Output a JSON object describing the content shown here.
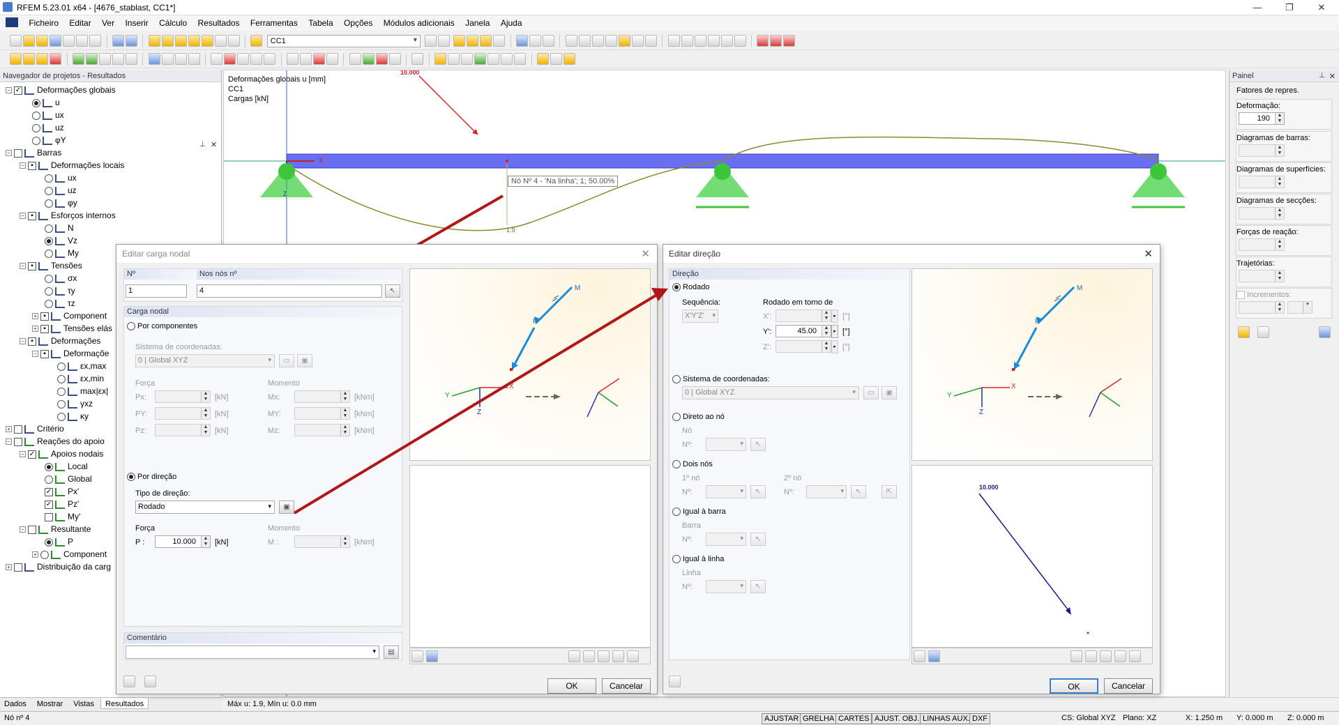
{
  "window": {
    "title": "RFEM 5.23.01 x64 - [4676_stablast, CC1*]",
    "min": "—",
    "max": "❐",
    "close": "✕"
  },
  "menu": [
    "Ficheiro",
    "Editar",
    "Ver",
    "Inserir",
    "Cálculo",
    "Resultados",
    "Ferramentas",
    "Tabela",
    "Opções",
    "Módulos adicionais",
    "Janela",
    "Ajuda"
  ],
  "toolbar": {
    "loadcase": "CC1"
  },
  "navigator": {
    "title": "Navegador de projetos - Resultados",
    "items": [
      "Deformações globais",
      "u",
      "ux",
      "uz",
      "φY",
      "Barras",
      "Deformações locais",
      "ux",
      "uz",
      "φy",
      "Esforços internos",
      "N",
      "Vz",
      "My",
      "Tensões",
      "σx",
      "τy",
      "τz",
      "Component",
      "Tensões elás",
      "Deformações",
      "Deformaçõe",
      "εx,max",
      "εx,min",
      "max|εx|",
      "γxz",
      "κy",
      "Critério",
      "Reações do apoio",
      "Apoios nodais",
      "Local",
      "Global",
      "Px'",
      "Pz'",
      "My'",
      "Resultante",
      "P",
      "Component",
      "Distribuição da carg"
    ],
    "tabs": [
      "Dados",
      "Mostrar",
      "Vistas",
      "Resultados"
    ]
  },
  "canvas": {
    "info_lines": [
      "Deformações globais u [mm]",
      "CC1",
      "Cargas [kN]"
    ],
    "load_value": "10.000",
    "node_tooltip": "Nó Nº 4 - 'Na linha'; 1; 50.00%",
    "defl_label": "1.9",
    "axis_x": "X",
    "axis_z": "Z"
  },
  "right_panel": {
    "title": "Painel",
    "heading": "Fatores de repres.",
    "deformacao_label": "Deformação:",
    "deformacao_value": "190",
    "labels": [
      "Diagramas de barras:",
      "Diagramas de superfícies:",
      "Diagramas de secções:",
      "Forças de reação:",
      "Trajetórias:",
      "Incrementos:"
    ]
  },
  "status": {
    "result_text": "Máx u: 1.9, Mín u: 0.0 mm",
    "node": "Nó nº 4",
    "buttons": [
      "AJUSTAR",
      "GRELHA",
      "CARTES",
      "AJUST. OBJ.",
      "LINHAS AUX.",
      "DXF"
    ],
    "cs": "CS: Global XYZ",
    "plane": "Plano: XZ",
    "x": "X: 1.250 m",
    "y": "Y: 0.000 m",
    "z": "Z: 0.000 m"
  },
  "dlg1": {
    "title": "Editar carga nodal",
    "no_label": "Nº",
    "no_value": "1",
    "nodes_label": "Nos nós nº",
    "nodes_value": "4",
    "group": "Carga nodal",
    "opt_components": "Por componentes",
    "coord_label": "Sistema de coordenadas:",
    "coord_value": "0 | Global XYZ",
    "force_label": "Força",
    "moment_label": "Momento",
    "px": "Px:",
    "py": "PY:",
    "pz": "Pz:",
    "mx": "Mx:",
    "my": "MY:",
    "mz": "Mz:",
    "kn": "[kN]",
    "knm": "[kNm]",
    "opt_direction": "Por direção",
    "dirtype_label": "Tipo de direção:",
    "dirtype_value": "Rodado",
    "force2_label": "Força",
    "moment2_label": "Momento",
    "p_label": "P :",
    "p_value": "10.000",
    "p_unit": "[kN]",
    "m_label": "M :",
    "m_unit": "[kNm]",
    "comment_label": "Comentário",
    "ok": "OK",
    "cancel": "Cancelar",
    "preview_labels": {
      "M": "M",
      "P": "P",
      "X": "X",
      "Y": "Y",
      "Z": "Z"
    }
  },
  "dlg2": {
    "title": "Editar direção",
    "group": "Direção",
    "opt_rotated": "Rodado",
    "seq_label": "Sequência:",
    "seq_value": "X'Y'Z'",
    "rot_label": "Rodado em torno de",
    "xp": "X':",
    "yp": "Y':",
    "zp": "Z':",
    "y_value": "45.00",
    "deg": "[°]",
    "opt_coord": "Sistema de coordenadas:",
    "coord_value": "0 | Global XYZ",
    "opt_node": "Direto ao nó",
    "node_lbl": "Nó",
    "n_lbl": "Nº:",
    "opt_two": "Dois nós",
    "first": "1º nó",
    "second": "2º nó",
    "opt_bar": "Igual à barra",
    "bar_lbl": "Barra",
    "opt_line": "Igual à linha",
    "line_lbl": "Linha",
    "ok": "OK",
    "cancel": "Cancelar",
    "preview_value": "10.000"
  },
  "colors": {
    "beam": "#6a6ef0",
    "support": "#5cd65c",
    "arrow": "#b01818",
    "axis_red": "#e02020",
    "axis_green": "#2a9a2a",
    "axis_blue": "#2030a0",
    "load_blue": "#1a8ad6"
  }
}
